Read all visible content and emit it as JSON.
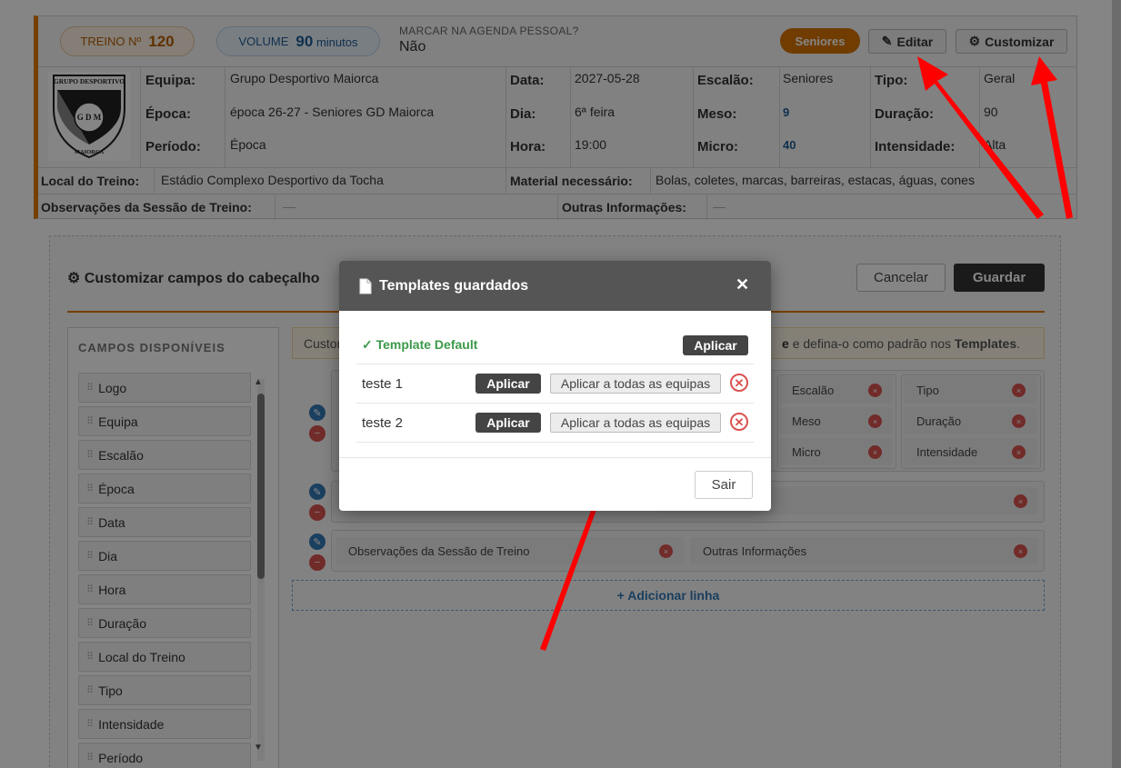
{
  "header": {
    "treino_label": "TREINO Nº",
    "treino_num": "120",
    "volume_label": "VOLUME",
    "volume_num": "90",
    "volume_unit": "minutos",
    "agenda_question": "MARCAR NA AGENDA PESSOAL?",
    "agenda_answer": "Não",
    "badge": "Seniores",
    "edit_label": "Editar",
    "customize_label": "Customizar"
  },
  "info": {
    "equipa_label": "Equipa:",
    "equipa": "Grupo Desportivo Maiorca",
    "epoca_label": "Época:",
    "epoca": "época 26-27 - Seniores GD Maiorca",
    "periodo_label": "Período:",
    "periodo": "Época",
    "data_label": "Data:",
    "data": "2027-05-28",
    "dia_label": "Dia:",
    "dia": "6ª feira",
    "hora_label": "Hora:",
    "hora": "19:00",
    "escalao_label": "Escalão:",
    "escalao": "Seniores",
    "meso_label": "Meso:",
    "meso": "9",
    "micro_label": "Micro:",
    "micro": "40",
    "tipo_label": "Tipo:",
    "tipo": "Geral",
    "duracao_label": "Duração:",
    "duracao": "90",
    "intensidade_label": "Intensidade:",
    "intensidade": "Alta",
    "local_label": "Local do Treino:",
    "local": "Estádio Complexo Desportivo da Tocha",
    "material_label": "Material necessário:",
    "material": "Bolas, coletes, marcas, barreiras, estacas, águas, cones",
    "obs_label": "Observações da Sessão de Treino:",
    "obs": "—",
    "outras_label": "Outras Informações:",
    "outras": "—"
  },
  "logo": {
    "text_top": "GRUPO DESPORTIVO",
    "letters": "G D M",
    "text_bottom": "MAIORCA"
  },
  "customize": {
    "title": "Customizar campos do cabeçalho",
    "cancel": "Cancelar",
    "save": "Guardar",
    "available_title": "CAMPOS DISPONÍVEIS",
    "available": [
      "Logo",
      "Equipa",
      "Escalão",
      "Época",
      "Data",
      "Dia",
      "Hora",
      "Duração",
      "Local do Treino",
      "Tipo",
      "Intensidade",
      "Período"
    ],
    "notice_start": "Custom",
    "notice_end": "e defina-o como padrão nos",
    "notice_bold": "Templates",
    "chips_row1": [
      "Escalão",
      "Meso",
      "Micro"
    ],
    "chips_row1b": [
      "Tipo",
      "Duração",
      "Intensidade"
    ],
    "chip_obs": "Observações da Sessão de Treino",
    "chip_outras": "Outras Informações",
    "add_line": "+ Adicionar linha"
  },
  "modal": {
    "title": "Templates guardados",
    "default_name": "✓ Template Default",
    "apply": "Aplicar",
    "apply_all": "Aplicar a todas as equipas",
    "templates": [
      {
        "name": "teste 1"
      },
      {
        "name": "teste 2"
      }
    ],
    "exit": "Sair"
  },
  "colors": {
    "accent": "#e07b00",
    "danger": "#d9534f",
    "primary": "#337ab7",
    "success": "#3c9a4a"
  }
}
